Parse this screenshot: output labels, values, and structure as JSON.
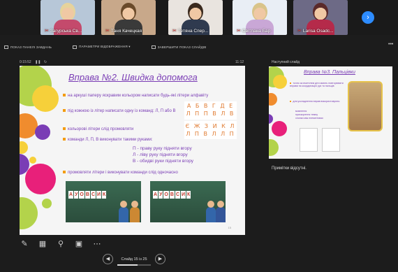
{
  "participants": [
    {
      "name": "Загурська Св...",
      "bg": "#b7c7d8",
      "hair": "#e6d39c",
      "shirt": "#c44a6c"
    },
    {
      "name": "Таня Качецкая",
      "bg": "#c8a88a",
      "hair": "#6a4a2a",
      "shirt": "#3a3a3a"
    },
    {
      "name": "Тетяна Спер...",
      "bg": "#e9e4df",
      "hair": "#3a2a1e",
      "shirt": "#2f3a4f"
    },
    {
      "name": "Світлана Бар",
      "bg": "#e9eef5",
      "hair": "#d9c48a",
      "shirt": "#c9a7d6"
    },
    {
      "name": "Larisa Osadc...",
      "bg": "#6d6a86",
      "hair": "#5a2a2a",
      "shirt": "#b52a4a"
    }
  ],
  "toolbar": {
    "show_taskbar": "ПОКАЗ ПАНЕЛІ ЗАВДАНЬ",
    "display_settings": "ПАРАМЕТРИ ВІДОБРАЖЕННЯ ▾",
    "end_show": "ЗАВЕРШИТИ ПОКАЗ СЛАЙДІВ"
  },
  "timer": {
    "elapsed": "0:15:52",
    "clock": "11:12"
  },
  "next_slide_label": "Наступний слайд",
  "slide": {
    "title": "Вправа №2. Швидка допомога",
    "bullets": [
      "на аркуші паперу яскравим кольором написати будь-які літери алфавіту",
      "під кожною із літер написати одну із команд: Л, П або В",
      "кольорові літери слід промовляти",
      "команди Л, П, В виконувати такими руками:",
      "промовляти літери і виконувати команди слід одночасно"
    ],
    "commands": [
      "П - праву руку підняти вгору",
      "Л - ліву руку підняти вгору",
      "В - обидві руки підняти вгору"
    ],
    "letter_rows": [
      "А Б В Г Д Е",
      "Л П П В Л В",
      "Є Ж З И К Л",
      "Л П В Л Л П"
    ],
    "sign_letters": [
      "А",
      "У",
      "О",
      "В",
      "С",
      "И",
      "К"
    ],
    "page": "15"
  },
  "next_slide": {
    "title": "Вправа №3. Пальцівки",
    "bullets": [
      "точно за вчителем діти мають повторювати вправи на координацію рук та пальців",
      "для ускладнення вправ використовують:",
      "мовлення",
      "прискорення темпу",
      "хлопки між елементами"
    ]
  },
  "notes": "Примітки відсутні.",
  "navigation": {
    "counter": "Слайд 15 із 25",
    "progress_fraction": 0.6
  },
  "colors": {
    "accent": "#7a3db5",
    "bullet": "#f39c12",
    "zoom_blue": "#2d8cff"
  }
}
